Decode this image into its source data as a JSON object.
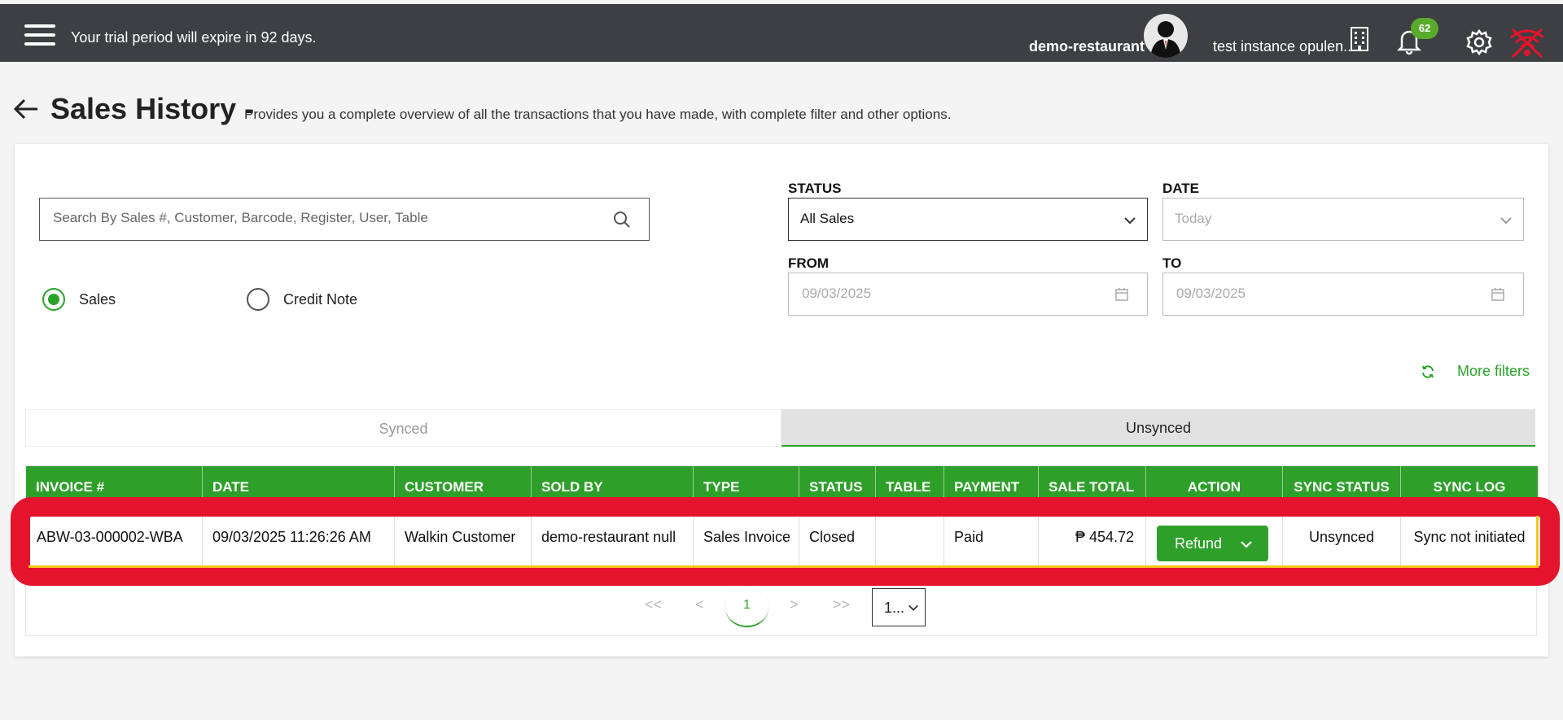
{
  "topbar": {
    "trial_text": "Your trial period will expire in 92 days.",
    "restaurant": "demo-restaurant",
    "instance": "test instance opulen...",
    "notification_count": "62"
  },
  "header": {
    "title": "Sales History -",
    "subtitle": "Provides you a complete overview of all the transactions that you have made, with complete filter and other options."
  },
  "filters": {
    "search_placeholder": "Search By Sales #, Customer, Barcode, Register, User, Table",
    "radio_sales": "Sales",
    "radio_credit_note": "Credit Note",
    "status_label": "STATUS",
    "status_value": "All Sales",
    "date_label": "DATE",
    "date_value": "Today",
    "from_label": "FROM",
    "from_value": "09/03/2025",
    "to_label": "TO",
    "to_value": "09/03/2025",
    "more_filters": "More filters"
  },
  "tabs": {
    "synced": "Synced",
    "unsynced": "Unsynced"
  },
  "table": {
    "headers": [
      "INVOICE #",
      "DATE",
      "CUSTOMER",
      "SOLD BY",
      "TYPE",
      "STATUS",
      "TABLE",
      "PAYMENT",
      "SALE TOTAL",
      "ACTION",
      "SYNC STATUS",
      "SYNC LOG"
    ],
    "rows": [
      {
        "invoice": "ABW-03-000002-WBA",
        "date": "09/03/2025 11:26:26 AM",
        "customer": "Walkin Customer",
        "sold_by": "demo-restaurant null",
        "type": "Sales Invoice",
        "status": "Closed",
        "table": "",
        "payment": "Paid",
        "sale_total": "₱ 454.72",
        "action": "Refund",
        "sync_status": "Unsynced",
        "sync_log": "Sync not initiated"
      }
    ]
  },
  "pagination": {
    "first": "<<",
    "prev": "<",
    "current": "1",
    "next": ">",
    "last": ">>",
    "page_size": "1..."
  },
  "colors": {
    "accent": "#2ea02a",
    "topbar": "#3d3f42",
    "annotation": "#e3142b"
  }
}
